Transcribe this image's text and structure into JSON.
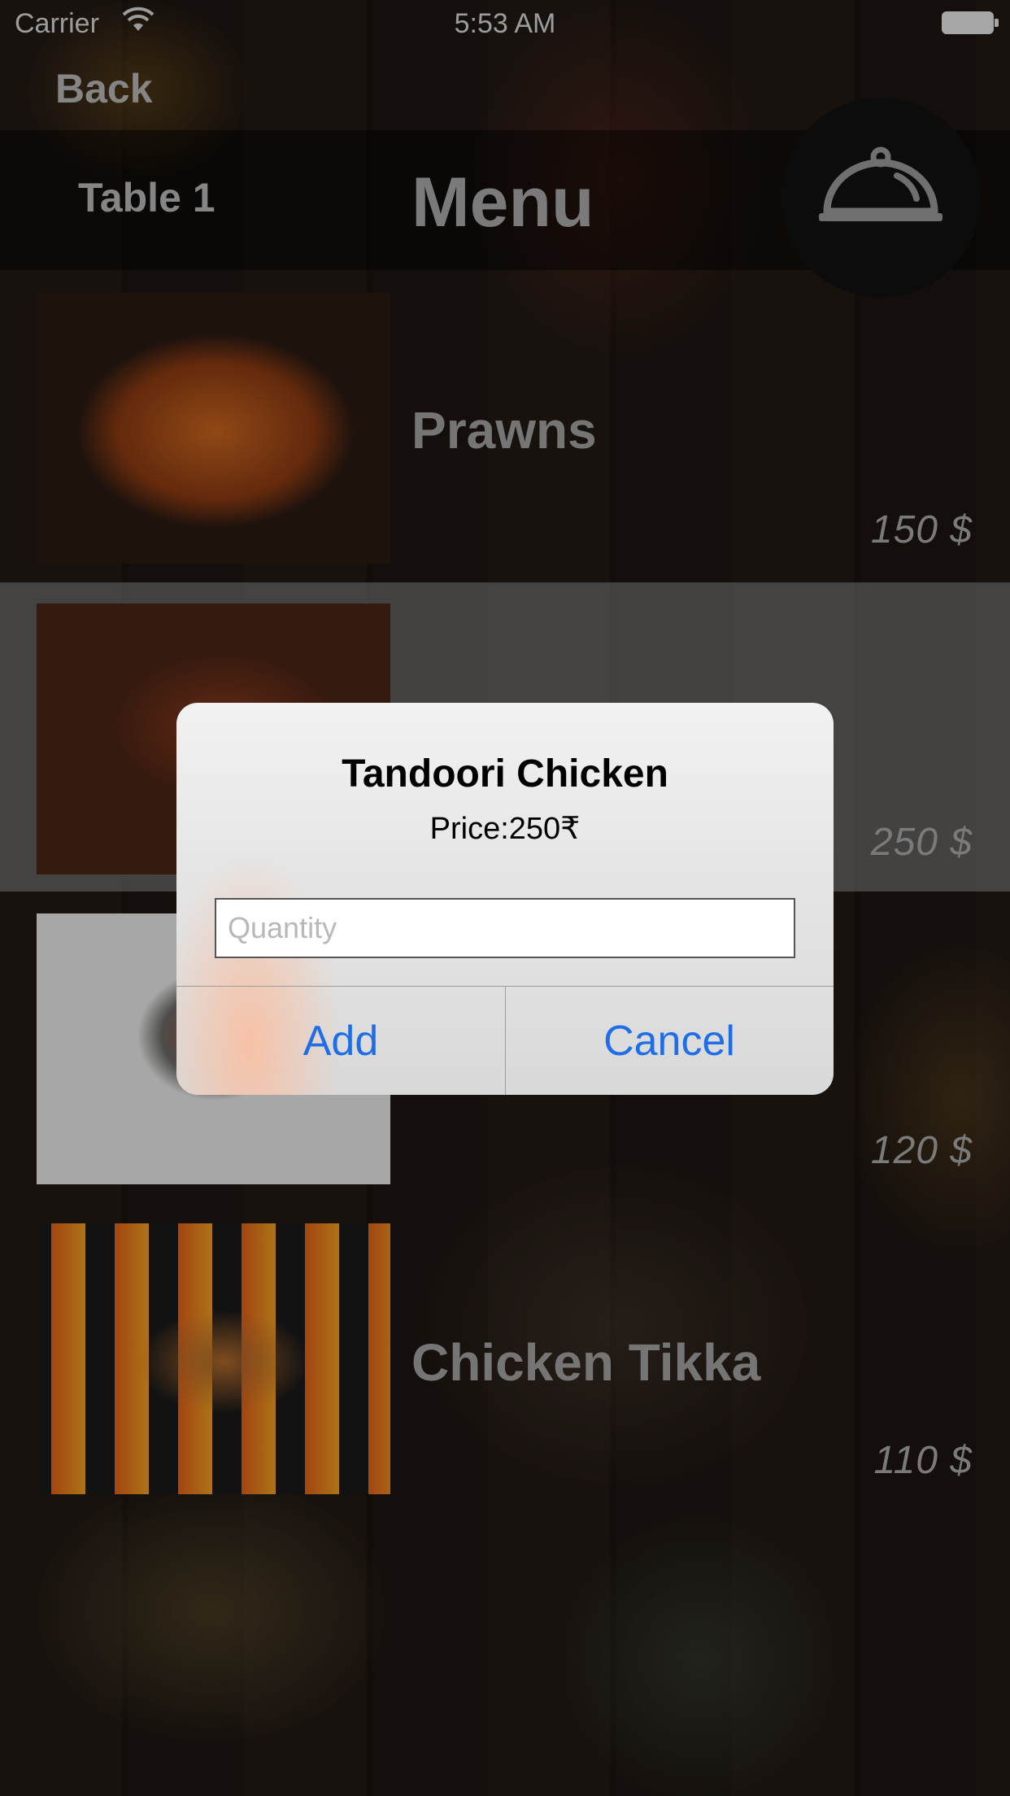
{
  "status_bar": {
    "carrier": "Carrier",
    "time": "5:53 AM"
  },
  "nav": {
    "back_label": "Back",
    "table_label": "Table 1",
    "title": "Menu",
    "cart_icon": "serving-cloche-icon"
  },
  "menu_items": [
    {
      "name": "Prawns",
      "price": "150 $"
    },
    {
      "name": "",
      "price": "250 $"
    },
    {
      "name": "",
      "price": "120 $"
    },
    {
      "name": "Chicken Tikka",
      "price": "110 $"
    }
  ],
  "alert": {
    "title": "Tandoori Chicken",
    "message": "Price:250₹",
    "input_placeholder": "Quantity",
    "input_value": "",
    "add_label": "Add",
    "cancel_label": "Cancel"
  },
  "colors": {
    "accent": "#1f6ee8",
    "alert_background": "#e6e6e6",
    "nav_text": "#b9b9b9"
  }
}
